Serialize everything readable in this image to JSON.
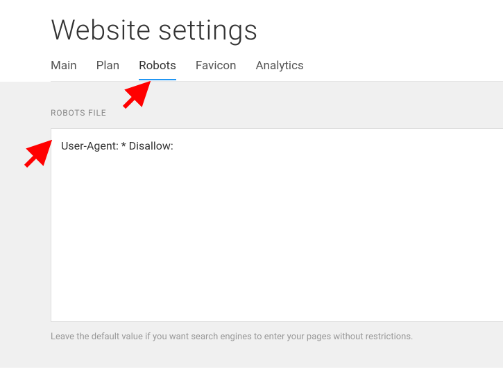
{
  "header": {
    "title": "Website settings"
  },
  "tabs": [
    {
      "label": "Main",
      "active": false
    },
    {
      "label": "Plan",
      "active": false
    },
    {
      "label": "Robots",
      "active": true
    },
    {
      "label": "Favicon",
      "active": false
    },
    {
      "label": "Analytics",
      "active": false
    }
  ],
  "section": {
    "label": "ROBOTS FILE",
    "textarea_value": "User-Agent: * Disallow:",
    "help_text": "Leave the default value if you want search engines to enter your pages without restrictions."
  }
}
